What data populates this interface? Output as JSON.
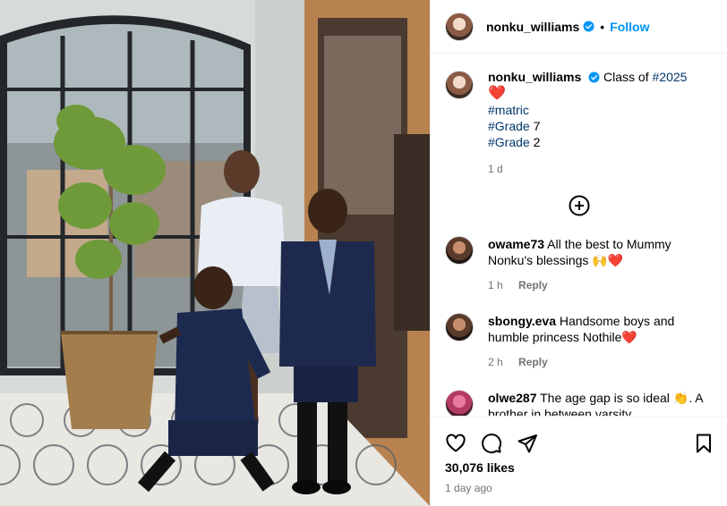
{
  "post": {
    "username": "nonku_williams",
    "follow_label": "Follow",
    "photo_alt": "Three children in school uniforms in front of a glass door",
    "caption": {
      "username": "nonku_williams",
      "text": "Class of ",
      "hashtag_class": "#2025",
      "heart": "❤️",
      "line_matric": "#matric",
      "grade7_tag": "#Grade",
      "grade7_num": " 7",
      "grade2_tag": "#Grade",
      "grade2_num": " 2",
      "time_ago": "1 d"
    },
    "comments": [
      {
        "username": "owame73",
        "text": "All the best to Mummy Nonku's blessings 🙌❤️",
        "time": "1 h",
        "reply": "Reply"
      },
      {
        "username": "sbongy.eva",
        "text": "Handsome boys and humble princess Nothile❤️",
        "time": "2 h",
        "reply": "Reply"
      },
      {
        "username": "olwe287",
        "text": "The age gap is so ideal 👏. A brother in between varsity",
        "time": "",
        "reply": ""
      }
    ],
    "likes": "30,076 likes",
    "date": "1 day ago"
  },
  "colors": {
    "accent": "#0095f6",
    "hashtag": "#00376b",
    "muted": "#737373"
  },
  "icons": [
    "verified-badge-icon",
    "add-circle-icon",
    "heart-icon",
    "comment-icon",
    "share-icon",
    "bookmark-icon"
  ]
}
